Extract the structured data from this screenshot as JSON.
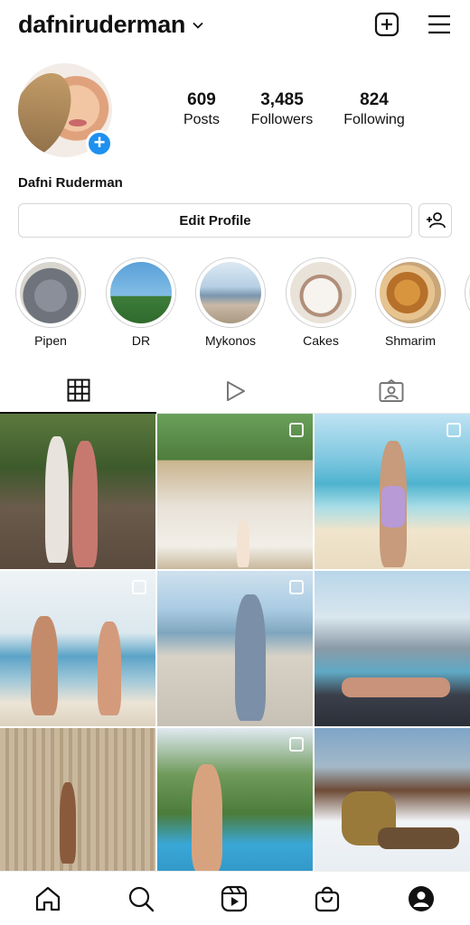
{
  "header": {
    "username": "dafniruderman",
    "icons": [
      "chevron-down-icon",
      "new-post-icon",
      "menu-icon"
    ]
  },
  "profile": {
    "stats": [
      {
        "num": "609",
        "label": "Posts"
      },
      {
        "num": "3,485",
        "label": "Followers"
      },
      {
        "num": "824",
        "label": "Following"
      }
    ],
    "full_name": "Dafni Ruderman",
    "edit_label": "Edit Profile"
  },
  "highlights": [
    {
      "label": "Pipen"
    },
    {
      "label": "DR"
    },
    {
      "label": "Mykonos"
    },
    {
      "label": "Cakes"
    },
    {
      "label": "Shmarim"
    }
  ],
  "tabs": [
    "grid-icon",
    "reels-icon",
    "tagged-icon"
  ],
  "bottom_nav": [
    "home-icon",
    "search-icon",
    "reels-icon",
    "shop-icon",
    "profile-icon"
  ],
  "colors": {
    "accent": "#1e90f0",
    "border": "#d6d6d6",
    "text": "#111111"
  }
}
